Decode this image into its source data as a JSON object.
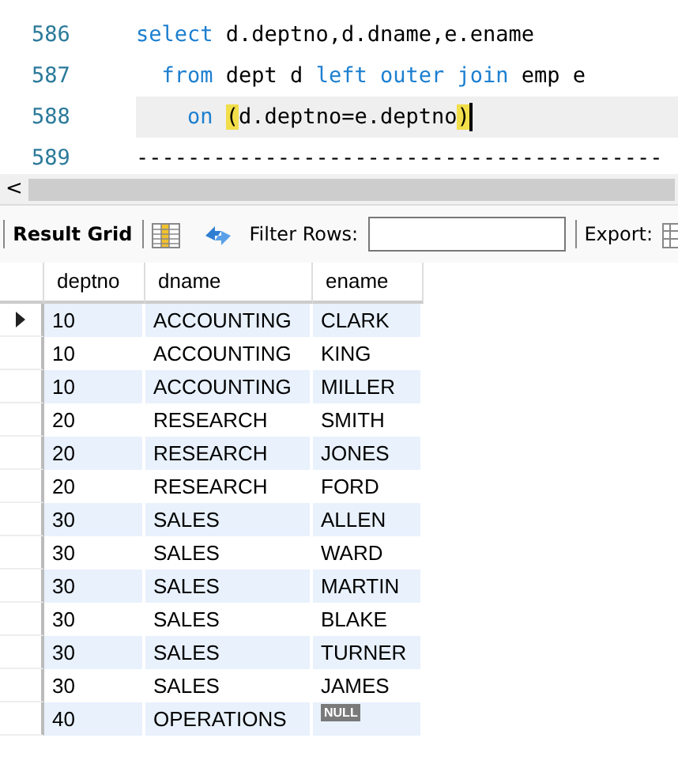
{
  "editor": {
    "lines": [
      {
        "number": "586",
        "current": false,
        "cursor": false,
        "tokens": [
          {
            "text": "select",
            "kind": "keyword"
          },
          {
            "text": " d.deptno,d.dname,e.ename",
            "kind": "plain"
          }
        ]
      },
      {
        "number": "587",
        "current": false,
        "cursor": false,
        "tokens": [
          {
            "text": "  from",
            "kind": "keyword"
          },
          {
            "text": " dept d ",
            "kind": "plain"
          },
          {
            "text": "left outer join",
            "kind": "keyword"
          },
          {
            "text": " emp e",
            "kind": "plain"
          }
        ]
      },
      {
        "number": "588",
        "current": true,
        "cursor": true,
        "tokens": [
          {
            "text": "    on ",
            "kind": "keyword"
          },
          {
            "text": "(",
            "kind": "bracket"
          },
          {
            "text": "d.deptno=e.deptno",
            "kind": "plain"
          },
          {
            "text": ")",
            "kind": "bracket"
          }
        ]
      },
      {
        "number": "589",
        "current": false,
        "cursor": false,
        "tokens": [
          {
            "text": "-----------------------------------------",
            "kind": "plain"
          }
        ]
      }
    ],
    "scroll_arrow": "<"
  },
  "toolbar": {
    "tab": "Result Grid",
    "filter_label": "Filter Rows:",
    "export_label": "Export:"
  },
  "table": {
    "columns": [
      "deptno",
      "dname",
      "ename"
    ],
    "rows": [
      {
        "current": true,
        "cells": [
          "10",
          "ACCOUNTING",
          "CLARK"
        ]
      },
      {
        "current": false,
        "cells": [
          "10",
          "ACCOUNTING",
          "KING"
        ]
      },
      {
        "current": false,
        "cells": [
          "10",
          "ACCOUNTING",
          "MILLER"
        ]
      },
      {
        "current": false,
        "cells": [
          "20",
          "RESEARCH",
          "SMITH"
        ]
      },
      {
        "current": false,
        "cells": [
          "20",
          "RESEARCH",
          "JONES"
        ]
      },
      {
        "current": false,
        "cells": [
          "20",
          "RESEARCH",
          "FORD"
        ]
      },
      {
        "current": false,
        "cells": [
          "30",
          "SALES",
          "ALLEN"
        ]
      },
      {
        "current": false,
        "cells": [
          "30",
          "SALES",
          "WARD"
        ]
      },
      {
        "current": false,
        "cells": [
          "30",
          "SALES",
          "MARTIN"
        ]
      },
      {
        "current": false,
        "cells": [
          "30",
          "SALES",
          "BLAKE"
        ]
      },
      {
        "current": false,
        "cells": [
          "30",
          "SALES",
          "TURNER"
        ]
      },
      {
        "current": false,
        "cells": [
          "30",
          "SALES",
          "JAMES"
        ]
      },
      {
        "current": false,
        "cells": [
          "40",
          "OPERATIONS",
          {
            "text": "NULL",
            "kind": "null"
          }
        ]
      }
    ]
  }
}
